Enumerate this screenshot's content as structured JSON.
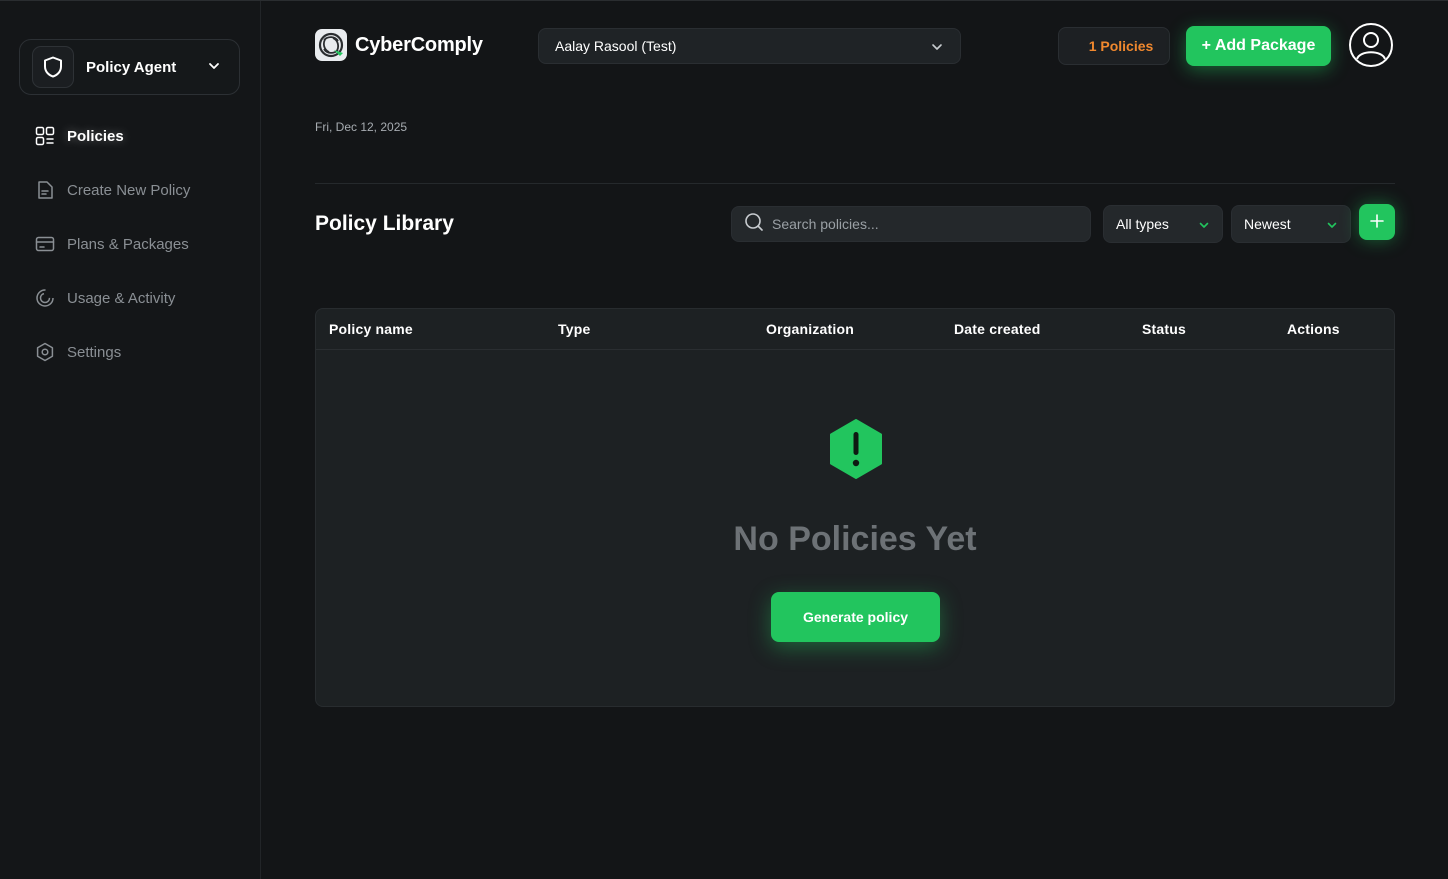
{
  "sidebar": {
    "agent_label": "Policy Agent",
    "items": [
      {
        "label": "Policies",
        "active": true
      },
      {
        "label": "Create New Policy",
        "active": false
      },
      {
        "label": "Plans & Packages",
        "active": false
      },
      {
        "label": "Usage & Activity",
        "active": false
      },
      {
        "label": "Settings",
        "active": false
      }
    ]
  },
  "header": {
    "brand": "CyberComply",
    "organization": "Aalay Rasool (Test)",
    "policies_count": "1 Policies",
    "add_package": "+ Add Package"
  },
  "main": {
    "date": "Fri, Dec 12, 2025",
    "library_title": "Policy Library",
    "search_placeholder": "Search policies...",
    "type_filter": "All types",
    "sort_filter": "Newest",
    "table": {
      "columns": [
        "Policy name",
        "Type",
        "Organization",
        "Date created",
        "Status",
        "Actions"
      ],
      "rows": []
    },
    "empty_title": "No Policies Yet",
    "generate_label": "Generate policy"
  },
  "colors": {
    "accent": "#22c55e",
    "badge_text": "#f0882e",
    "background": "#131517"
  }
}
